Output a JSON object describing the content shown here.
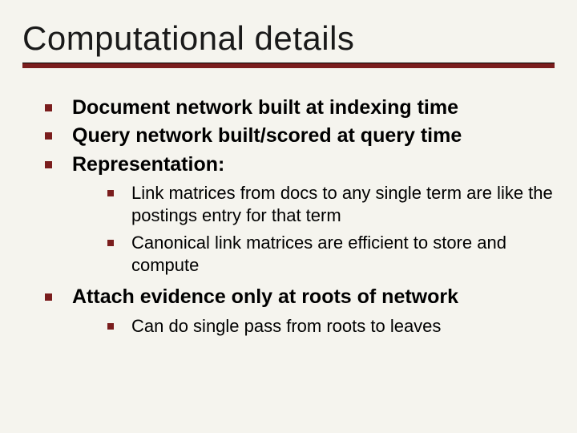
{
  "title": "Computational details",
  "bullets": {
    "b0": "Document network built at indexing time",
    "b1": "Query network built/scored at query time",
    "b2": "Representation:",
    "b2_sub": {
      "s0": "Link matrices from docs to any single term are like the postings entry for that term",
      "s1": "Canonical link matrices are efficient to store and compute"
    },
    "b3": "Attach evidence only at roots of network",
    "b3_sub": {
      "s0": "Can do single pass from roots to leaves"
    }
  }
}
